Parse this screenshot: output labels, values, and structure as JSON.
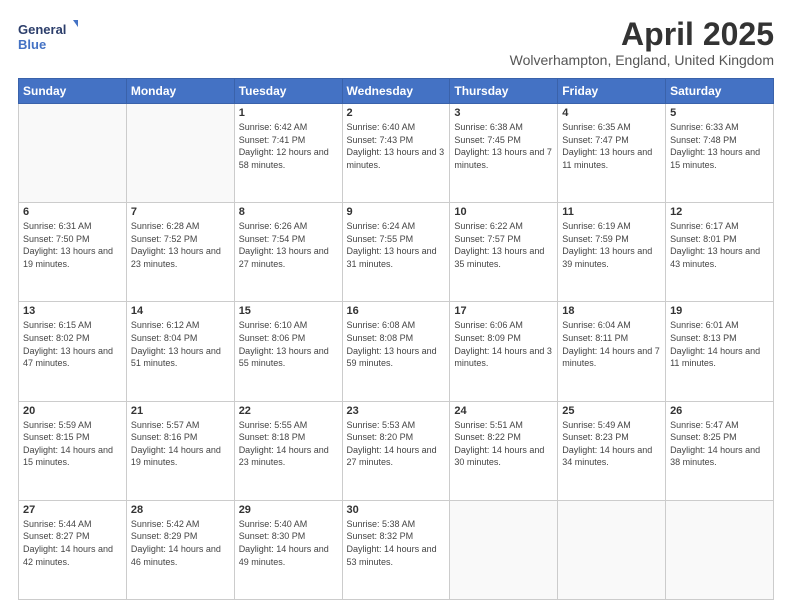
{
  "header": {
    "title": "April 2025",
    "subtitle": "Wolverhampton, England, United Kingdom",
    "logo_general": "General",
    "logo_blue": "Blue"
  },
  "days_of_week": [
    "Sunday",
    "Monday",
    "Tuesday",
    "Wednesday",
    "Thursday",
    "Friday",
    "Saturday"
  ],
  "weeks": [
    [
      {
        "day": "",
        "sunrise": "",
        "sunset": "",
        "daylight": ""
      },
      {
        "day": "",
        "sunrise": "",
        "sunset": "",
        "daylight": ""
      },
      {
        "day": "1",
        "sunrise": "Sunrise: 6:42 AM",
        "sunset": "Sunset: 7:41 PM",
        "daylight": "Daylight: 12 hours and 58 minutes."
      },
      {
        "day": "2",
        "sunrise": "Sunrise: 6:40 AM",
        "sunset": "Sunset: 7:43 PM",
        "daylight": "Daylight: 13 hours and 3 minutes."
      },
      {
        "day": "3",
        "sunrise": "Sunrise: 6:38 AM",
        "sunset": "Sunset: 7:45 PM",
        "daylight": "Daylight: 13 hours and 7 minutes."
      },
      {
        "day": "4",
        "sunrise": "Sunrise: 6:35 AM",
        "sunset": "Sunset: 7:47 PM",
        "daylight": "Daylight: 13 hours and 11 minutes."
      },
      {
        "day": "5",
        "sunrise": "Sunrise: 6:33 AM",
        "sunset": "Sunset: 7:48 PM",
        "daylight": "Daylight: 13 hours and 15 minutes."
      }
    ],
    [
      {
        "day": "6",
        "sunrise": "Sunrise: 6:31 AM",
        "sunset": "Sunset: 7:50 PM",
        "daylight": "Daylight: 13 hours and 19 minutes."
      },
      {
        "day": "7",
        "sunrise": "Sunrise: 6:28 AM",
        "sunset": "Sunset: 7:52 PM",
        "daylight": "Daylight: 13 hours and 23 minutes."
      },
      {
        "day": "8",
        "sunrise": "Sunrise: 6:26 AM",
        "sunset": "Sunset: 7:54 PM",
        "daylight": "Daylight: 13 hours and 27 minutes."
      },
      {
        "day": "9",
        "sunrise": "Sunrise: 6:24 AM",
        "sunset": "Sunset: 7:55 PM",
        "daylight": "Daylight: 13 hours and 31 minutes."
      },
      {
        "day": "10",
        "sunrise": "Sunrise: 6:22 AM",
        "sunset": "Sunset: 7:57 PM",
        "daylight": "Daylight: 13 hours and 35 minutes."
      },
      {
        "day": "11",
        "sunrise": "Sunrise: 6:19 AM",
        "sunset": "Sunset: 7:59 PM",
        "daylight": "Daylight: 13 hours and 39 minutes."
      },
      {
        "day": "12",
        "sunrise": "Sunrise: 6:17 AM",
        "sunset": "Sunset: 8:01 PM",
        "daylight": "Daylight: 13 hours and 43 minutes."
      }
    ],
    [
      {
        "day": "13",
        "sunrise": "Sunrise: 6:15 AM",
        "sunset": "Sunset: 8:02 PM",
        "daylight": "Daylight: 13 hours and 47 minutes."
      },
      {
        "day": "14",
        "sunrise": "Sunrise: 6:12 AM",
        "sunset": "Sunset: 8:04 PM",
        "daylight": "Daylight: 13 hours and 51 minutes."
      },
      {
        "day": "15",
        "sunrise": "Sunrise: 6:10 AM",
        "sunset": "Sunset: 8:06 PM",
        "daylight": "Daylight: 13 hours and 55 minutes."
      },
      {
        "day": "16",
        "sunrise": "Sunrise: 6:08 AM",
        "sunset": "Sunset: 8:08 PM",
        "daylight": "Daylight: 13 hours and 59 minutes."
      },
      {
        "day": "17",
        "sunrise": "Sunrise: 6:06 AM",
        "sunset": "Sunset: 8:09 PM",
        "daylight": "Daylight: 14 hours and 3 minutes."
      },
      {
        "day": "18",
        "sunrise": "Sunrise: 6:04 AM",
        "sunset": "Sunset: 8:11 PM",
        "daylight": "Daylight: 14 hours and 7 minutes."
      },
      {
        "day": "19",
        "sunrise": "Sunrise: 6:01 AM",
        "sunset": "Sunset: 8:13 PM",
        "daylight": "Daylight: 14 hours and 11 minutes."
      }
    ],
    [
      {
        "day": "20",
        "sunrise": "Sunrise: 5:59 AM",
        "sunset": "Sunset: 8:15 PM",
        "daylight": "Daylight: 14 hours and 15 minutes."
      },
      {
        "day": "21",
        "sunrise": "Sunrise: 5:57 AM",
        "sunset": "Sunset: 8:16 PM",
        "daylight": "Daylight: 14 hours and 19 minutes."
      },
      {
        "day": "22",
        "sunrise": "Sunrise: 5:55 AM",
        "sunset": "Sunset: 8:18 PM",
        "daylight": "Daylight: 14 hours and 23 minutes."
      },
      {
        "day": "23",
        "sunrise": "Sunrise: 5:53 AM",
        "sunset": "Sunset: 8:20 PM",
        "daylight": "Daylight: 14 hours and 27 minutes."
      },
      {
        "day": "24",
        "sunrise": "Sunrise: 5:51 AM",
        "sunset": "Sunset: 8:22 PM",
        "daylight": "Daylight: 14 hours and 30 minutes."
      },
      {
        "day": "25",
        "sunrise": "Sunrise: 5:49 AM",
        "sunset": "Sunset: 8:23 PM",
        "daylight": "Daylight: 14 hours and 34 minutes."
      },
      {
        "day": "26",
        "sunrise": "Sunrise: 5:47 AM",
        "sunset": "Sunset: 8:25 PM",
        "daylight": "Daylight: 14 hours and 38 minutes."
      }
    ],
    [
      {
        "day": "27",
        "sunrise": "Sunrise: 5:44 AM",
        "sunset": "Sunset: 8:27 PM",
        "daylight": "Daylight: 14 hours and 42 minutes."
      },
      {
        "day": "28",
        "sunrise": "Sunrise: 5:42 AM",
        "sunset": "Sunset: 8:29 PM",
        "daylight": "Daylight: 14 hours and 46 minutes."
      },
      {
        "day": "29",
        "sunrise": "Sunrise: 5:40 AM",
        "sunset": "Sunset: 8:30 PM",
        "daylight": "Daylight: 14 hours and 49 minutes."
      },
      {
        "day": "30",
        "sunrise": "Sunrise: 5:38 AM",
        "sunset": "Sunset: 8:32 PM",
        "daylight": "Daylight: 14 hours and 53 minutes."
      },
      {
        "day": "",
        "sunrise": "",
        "sunset": "",
        "daylight": ""
      },
      {
        "day": "",
        "sunrise": "",
        "sunset": "",
        "daylight": ""
      },
      {
        "day": "",
        "sunrise": "",
        "sunset": "",
        "daylight": ""
      }
    ]
  ]
}
